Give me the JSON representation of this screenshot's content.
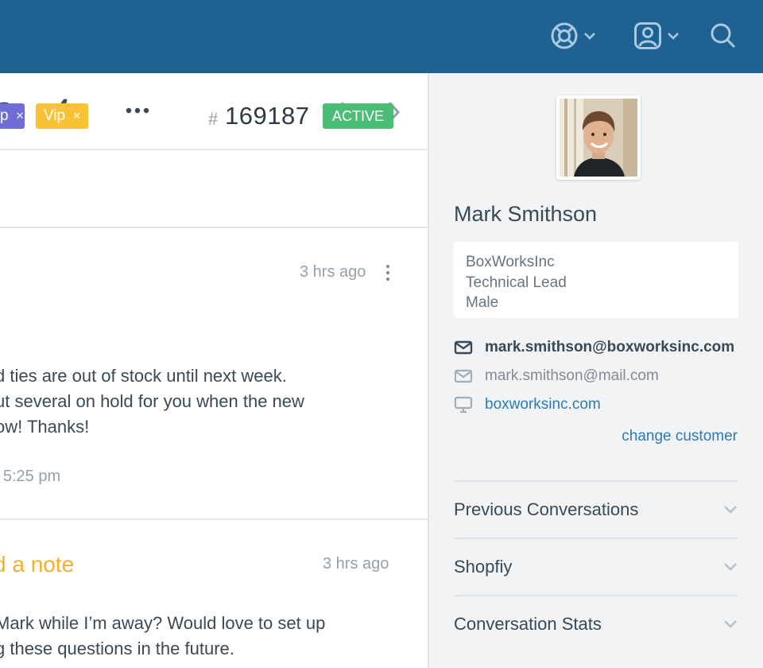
{
  "ticket": {
    "tags": [
      {
        "label": "p",
        "color": "#6f6dd6"
      },
      {
        "label": "Vip",
        "color": "#f8c234"
      }
    ],
    "hash": "#",
    "number": "169187",
    "status": "ACTIVE"
  },
  "thread": {
    "message": {
      "time": "3 hrs ago",
      "lines": [
        "d ties are out of stock until next week.",
        "ut several on hold for you when the new",
        "ow! Thanks!"
      ],
      "meta": "@ 5:25 pm"
    },
    "note": {
      "title": "d a note",
      "time": "3 hrs ago",
      "lines": [
        "Mark while I’m away? Would love to set up",
        "g these questions in the future."
      ]
    }
  },
  "customer": {
    "name": "Mark Smithson",
    "company": "BoxWorksInc",
    "title": "Technical Lead",
    "gender": "Male",
    "email_primary": "mark.smithson@boxworksinc.com",
    "email_secondary": "mark.smithson@mail.com",
    "website": "boxworksinc.com",
    "change_label": "change customer"
  },
  "sidebar_sections": [
    {
      "label": "Previous Conversations"
    },
    {
      "label": "Shopfiy"
    },
    {
      "label": "Conversation Stats"
    }
  ],
  "icons": {
    "help": "lifebuoy-icon",
    "profile": "user-icon",
    "search": "search-icon",
    "tag": "tag-icon",
    "workflow": "lightning-icon",
    "more": "more-icon",
    "prev": "chevron-left-icon",
    "next": "chevron-right-icon"
  },
  "colors": {
    "topbar": "#1f6190",
    "active_badge": "#4cbd76",
    "note_title": "#f5b02b",
    "link": "#2d7bb5",
    "sidebar_bg": "#f1f3f5"
  }
}
